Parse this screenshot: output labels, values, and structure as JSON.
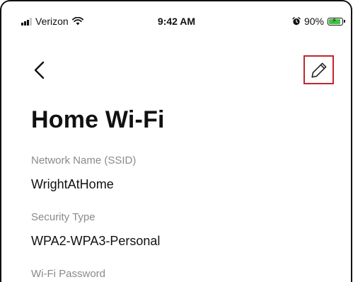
{
  "status_bar": {
    "carrier": "Verizon",
    "time": "9:42 AM",
    "battery_percent": "90%",
    "battery_level": 0.9,
    "battery_color": "#3ec43e",
    "icons": [
      "signal-bars-icon",
      "wifi-icon",
      "alarm-icon",
      "battery-charging-icon"
    ]
  },
  "nav": {
    "back_icon": "chevron-left-icon",
    "edit_icon": "pencil-icon",
    "highlight_color": "#c1272d"
  },
  "page": {
    "title": "Home Wi-Fi"
  },
  "fields": [
    {
      "label": "Network Name (SSID)",
      "value": "WrightAtHome"
    },
    {
      "label": "Security Type",
      "value": "WPA2-WPA3-Personal"
    },
    {
      "label": "Wi-Fi Password",
      "value": ""
    }
  ]
}
